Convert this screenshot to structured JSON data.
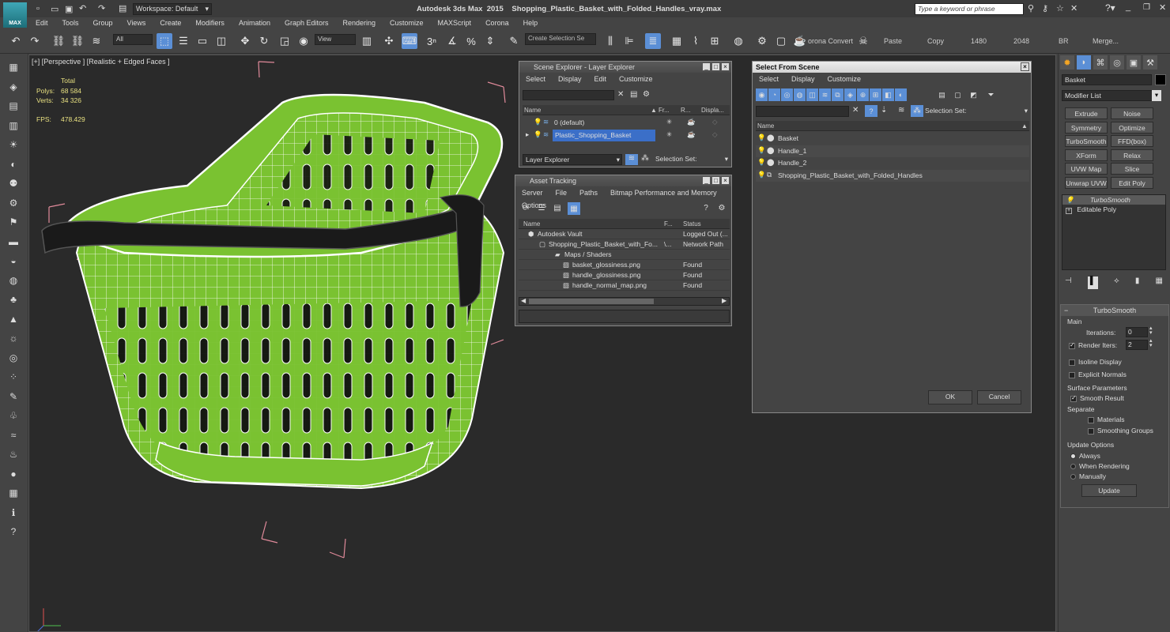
{
  "app": {
    "title": "Autodesk 3ds Max  2015    Shopping_Plastic_Basket_with_Folded_Handles_vray.max",
    "logo": "MAX",
    "workspace": "Workspace: Default",
    "search_placeholder": "Type a keyword or phrase"
  },
  "menu": [
    "Edit",
    "Tools",
    "Group",
    "Views",
    "Create",
    "Modifiers",
    "Animation",
    "Graph Editors",
    "Rendering",
    "Customize",
    "MAXScript",
    "Corona",
    "Help"
  ],
  "toolbar": {
    "filter": "All",
    "ref_coord": "View",
    "selection_set_placeholder": "Create Selection Se",
    "labels": [
      "orona Convert",
      "Paste",
      "Copy",
      "1480",
      "2048",
      "BR",
      "Merge..."
    ]
  },
  "viewport": {
    "label": "[+] [Perspective ] [Realistic + Edged Faces ]",
    "stats": {
      "total": "Total",
      "polys_label": "Polys:",
      "polys": "68 584",
      "verts_label": "Verts:",
      "verts": "34 326",
      "fps_label": "FPS:",
      "fps": "478.429"
    }
  },
  "scene_explorer": {
    "title": "Scene Explorer - Layer Explorer",
    "menu": [
      "Select",
      "Display",
      "Edit",
      "Customize"
    ],
    "columns": [
      "Name",
      "Fr...",
      "R...",
      "Displa..."
    ],
    "rows": [
      "0 (default)",
      "Plastic_Shopping_Basket"
    ],
    "footer_dropdown": "Layer Explorer",
    "selection_set": "Selection Set:"
  },
  "asset_tracking": {
    "title": "Asset Tracking",
    "menu": [
      "Server",
      "File",
      "Paths",
      "Bitmap Performance and Memory",
      "Options"
    ],
    "columns": [
      "Name",
      "F...",
      "Status"
    ],
    "rows": [
      {
        "name": "Autodesk Vault",
        "f": "",
        "status": "Logged Out (..."
      },
      {
        "name": "Shopping_Plastic_Basket_with_Fo...",
        "f": "\\...",
        "status": "Network Path"
      },
      {
        "name": "Maps / Shaders",
        "f": "",
        "status": ""
      },
      {
        "name": "basket_glossiness.png",
        "f": "",
        "status": "Found"
      },
      {
        "name": "handle_glossiness.png",
        "f": "",
        "status": "Found"
      },
      {
        "name": "handle_normal_map.png",
        "f": "",
        "status": "Found"
      }
    ]
  },
  "select_from_scene": {
    "title": "Select From Scene",
    "menu": [
      "Select",
      "Display",
      "Customize"
    ],
    "selection_set": "Selection Set:",
    "column": "Name",
    "rows": [
      "Basket",
      "Handle_1",
      "Handle_2",
      "Shopping_Plastic_Basket_with_Folded_Handles"
    ],
    "ok": "OK",
    "cancel": "Cancel"
  },
  "command_panel": {
    "object_name": "Basket",
    "modifier_list": "Modifier List",
    "buttons": [
      "Extrude",
      "Noise",
      "Symmetry",
      "Optimize",
      "TurboSmooth",
      "FFD(box)",
      "XForm",
      "Relax",
      "UVW Map",
      "Slice",
      "Unwrap UVW",
      "Edit Poly"
    ],
    "stack": [
      "TurboSmooth",
      "Editable Poly"
    ],
    "rollout_title": "TurboSmooth",
    "main": "Main",
    "iterations_label": "Iterations:",
    "iterations": "0",
    "render_iters_label": "Render Iters:",
    "render_iters": "2",
    "isoline": "Isoline Display",
    "explicit_normals": "Explicit Normals",
    "surface_params": "Surface Parameters",
    "smooth_result": "Smooth Result",
    "separate": "Separate",
    "materials": "Materials",
    "smoothing_groups": "Smoothing Groups",
    "update_options": "Update Options",
    "always": "Always",
    "when_rendering": "When Rendering",
    "manually": "Manually",
    "update": "Update"
  },
  "colors": {
    "basket_green": "#7ac231",
    "wire": "#ffffff",
    "handle": "#1a1a1a",
    "selection": "#3b6fc8"
  }
}
